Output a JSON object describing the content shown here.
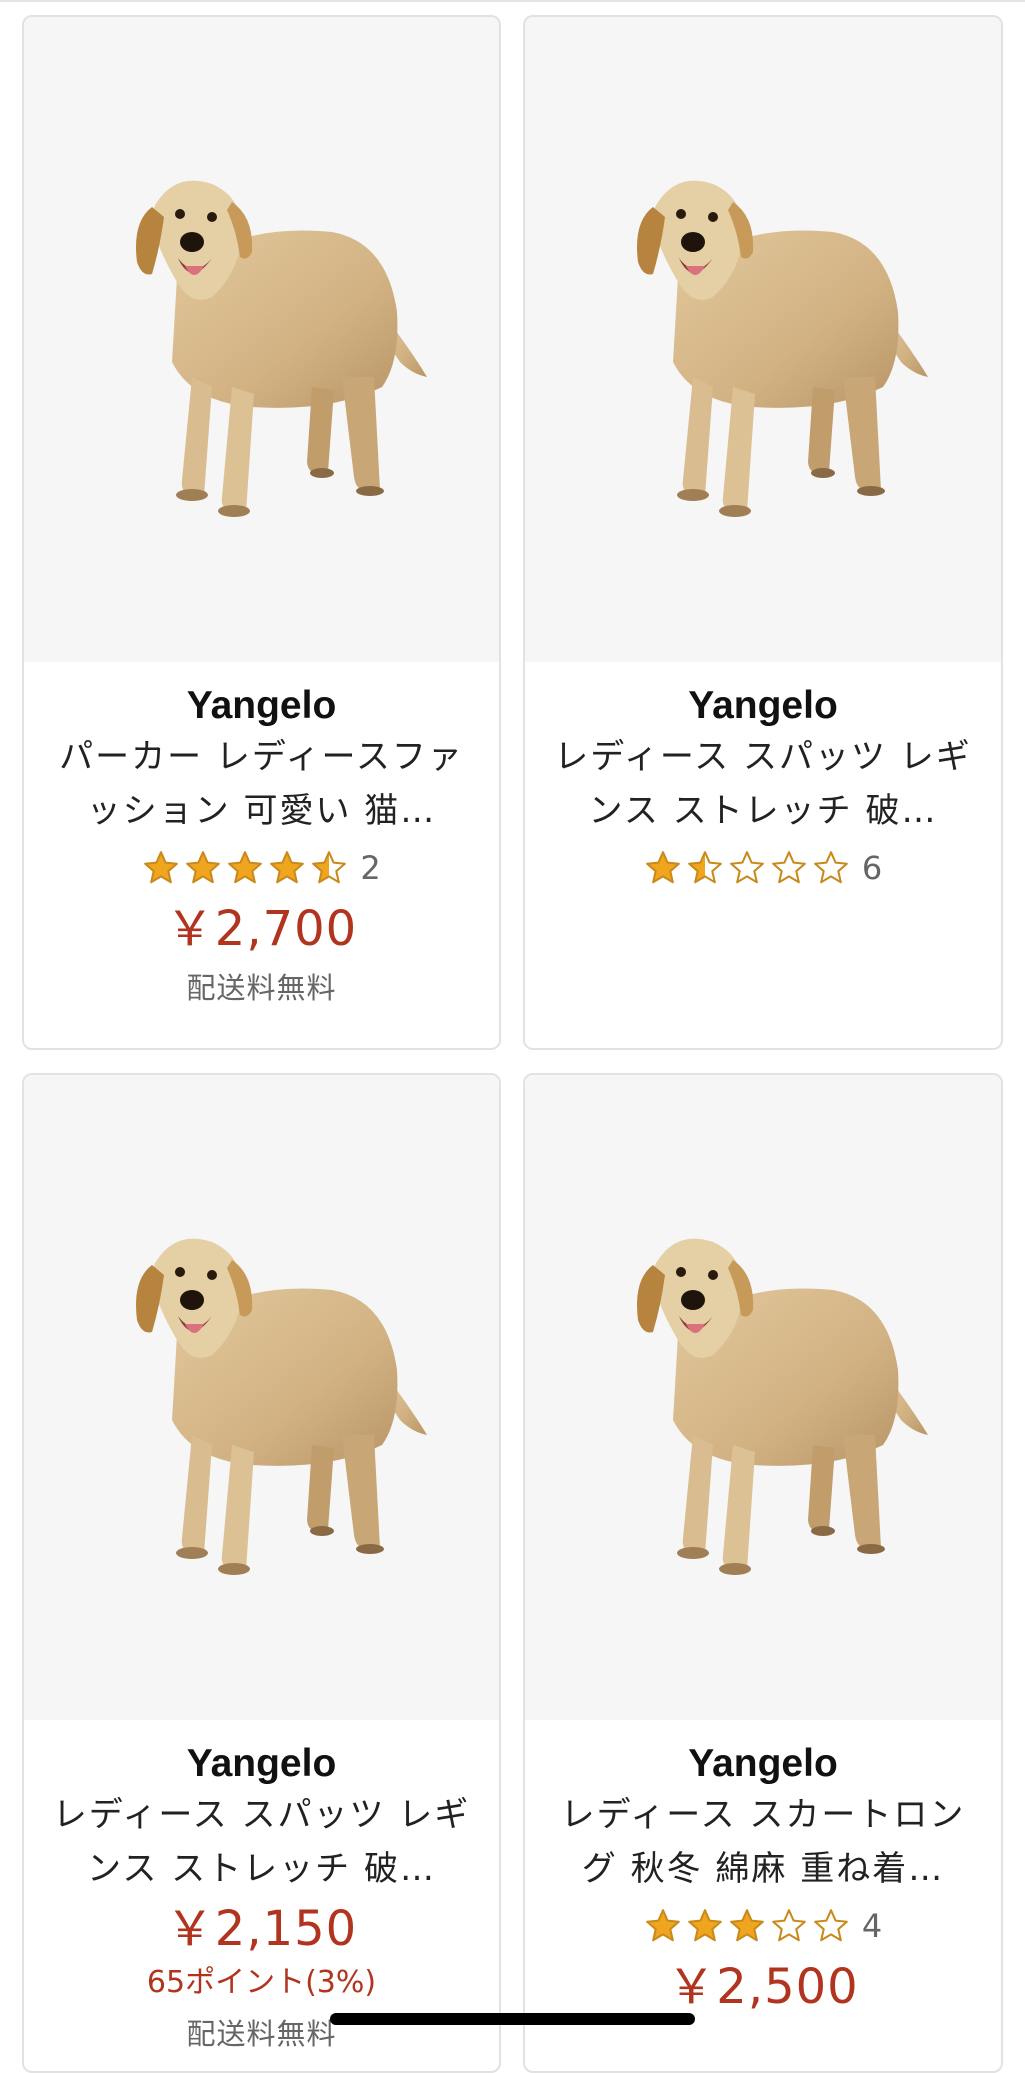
{
  "products": [
    {
      "brand": "Yangelo",
      "title": "パーカー レディースファッション 可愛い 猫…",
      "rating": 4.5,
      "review_count": "2",
      "price": "￥2,700",
      "points": "",
      "shipping": "配送料無料",
      "image_icon": "dog-product-image"
    },
    {
      "brand": "Yangelo",
      "title": "レディース スパッツ レギンス ストレッチ 破…",
      "rating": 1.5,
      "review_count": "6",
      "price": "",
      "points": "",
      "shipping": "",
      "image_icon": "dog-product-image"
    },
    {
      "brand": "Yangelo",
      "title": "レディース スパッツ レギンス ストレッチ 破…",
      "rating": null,
      "review_count": "",
      "price": "￥2,150",
      "points": "65ポイント(3%)",
      "shipping": "配送料無料",
      "image_icon": "dog-product-image"
    },
    {
      "brand": "Yangelo",
      "title": "レディース スカートロング 秋冬 綿麻 重ね着…",
      "rating": 3,
      "review_count": "4",
      "price": "￥2,500",
      "points": "",
      "shipping": "",
      "image_icon": "dog-product-image"
    }
  ],
  "colors": {
    "price": "#b1341f",
    "star": "#f0a51f",
    "star_outline": "#c98a1c",
    "card_border": "#e2e2e2",
    "image_bg": "#f6f6f7"
  }
}
